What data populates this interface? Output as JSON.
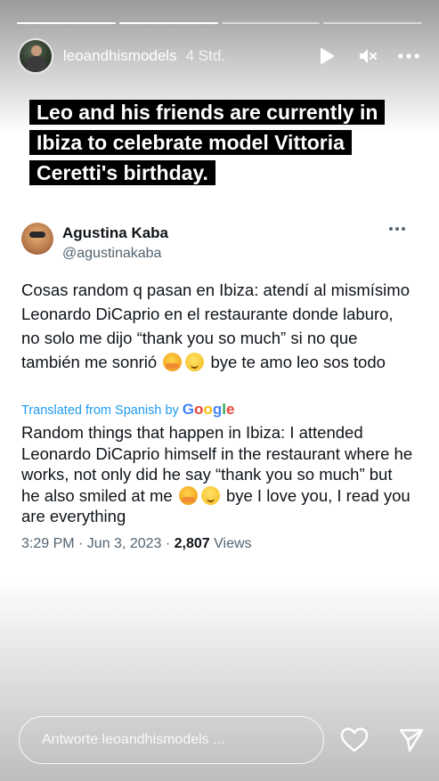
{
  "story": {
    "progress": [
      1.0,
      1.0,
      0.0,
      0.0
    ],
    "username": "leoandhismodels",
    "time": "4 Std."
  },
  "header_icons": {
    "play": "play-icon",
    "mute": "mute-icon",
    "more": "more-icon"
  },
  "caption": {
    "line1": "Leo and his friends are currently in",
    "line2": "Ibiza to celebrate model Vittoria",
    "line3": "Ceretti's birthday."
  },
  "tweet": {
    "name": "Agustina Kaba",
    "handle": "@agustinakaba",
    "text_part1": "Cosas random q pasan en Ibiza: atendí al mismísimo Leonardo DiCaprio en el restaurante donde laburo, no solo me dijo “thank you so much” si no que también me sonrió",
    "text_part2": " bye te amo leo sos todo",
    "translated_prefix": "Translated from Spanish by ",
    "translated_brand": "Google",
    "translation_part1": "Random things that happen in Ibiza: I attended Leonardo DiCaprio himself in the restaurant where he works, not only did he say “thank you so much” but he also smiled at me",
    "translation_part2": " bye I love you, I read you are everything",
    "time_date": "3:29 PM · Jun 3, 2023 · ",
    "views_count": "2,807",
    "views_label": " Views"
  },
  "reply": {
    "placeholder": "Antworte leoandhismodels ..."
  },
  "bottom_icons": {
    "like": "heart-icon",
    "send": "send-icon"
  }
}
